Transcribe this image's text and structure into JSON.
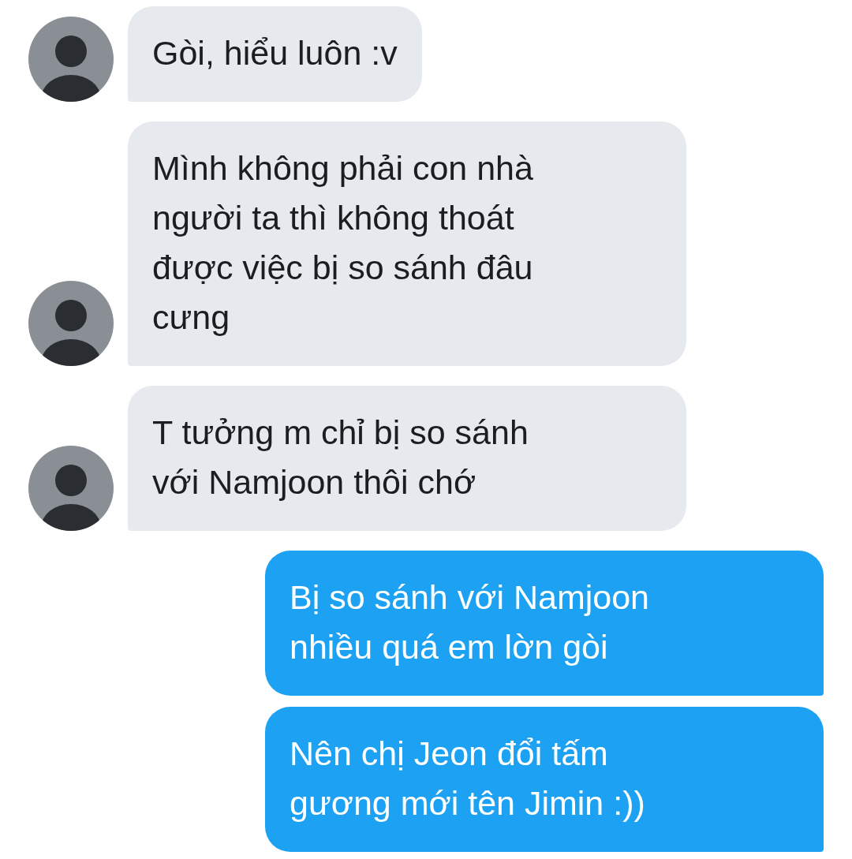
{
  "messages": [
    {
      "kind": "incoming",
      "avatar": true,
      "lines": [
        "Gòi, hiểu luôn :v"
      ]
    },
    {
      "kind": "incoming",
      "avatar": true,
      "lines": [
        "Mình không phải con nhà",
        "người ta thì không thoát",
        "được việc bị so sánh đâu",
        "cưng"
      ]
    },
    {
      "kind": "incoming",
      "avatar": true,
      "lines": [
        "T tưởng m chỉ bị so sánh",
        "với Namjoon thôi chớ"
      ]
    },
    {
      "kind": "outgoing",
      "lines": [
        "Bị so sánh với Namjoon",
        "nhiều quá em lờn gòi"
      ]
    },
    {
      "kind": "outgoing",
      "lines": [
        "Nên chị Jeon đổi tấm",
        "gương mới tên Jimin :))"
      ]
    }
  ]
}
